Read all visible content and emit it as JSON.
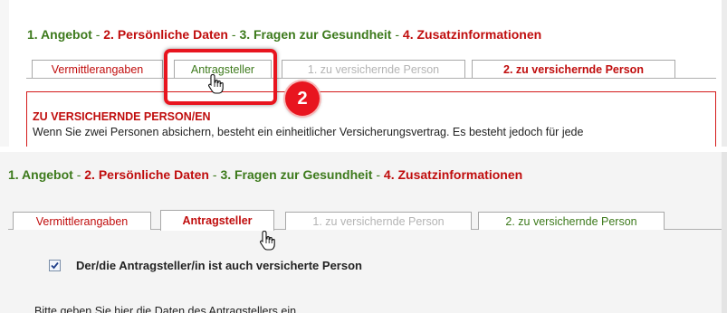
{
  "top": {
    "steps": [
      {
        "label": "1. Angebot",
        "state": "done"
      },
      {
        "label": "2. Persönliche Daten",
        "state": "open"
      },
      {
        "label": "3. Fragen zur Gesundheit",
        "state": "done"
      },
      {
        "label": "4. Zusatzinformationen",
        "state": "open"
      }
    ],
    "separator": " - ",
    "tabs": [
      {
        "label": "Vermittlerangaben"
      },
      {
        "label": "Antragsteller"
      },
      {
        "label": "1. zu versichernde Person"
      },
      {
        "label": "2. zu versichernde Person"
      }
    ],
    "info_title": "ZU VERSICHERNDE PERSON/EN",
    "info_text": "Wenn Sie zwei Personen absichern, besteht ein einheitlicher Versicherungsvertrag. Es besteht jedoch für jede",
    "badge_number": "2"
  },
  "bottom": {
    "steps": [
      {
        "label": "1. Angebot",
        "state": "done"
      },
      {
        "label": "2. Persönliche Daten",
        "state": "open"
      },
      {
        "label": "3. Fragen zur Gesundheit",
        "state": "done"
      },
      {
        "label": "4. Zusatzinformationen",
        "state": "open"
      }
    ],
    "separator": " - ",
    "tabs": [
      {
        "label": "Vermittlerangaben"
      },
      {
        "label": "Antragsteller"
      },
      {
        "label": "1. zu versichernde Person"
      },
      {
        "label": "2. zu versichernde Person"
      }
    ],
    "checkbox_label": "Der/die Antragsteller/in ist auch versicherte Person",
    "checkbox_checked": true,
    "intro_text": "Bitte geben Sie hier die Daten des Antragstellers ein"
  },
  "colors": {
    "step_done": "#3d7a1c",
    "step_open": "#c00d0d",
    "highlight": "#e8151f"
  },
  "icons": [
    "hand-pointer-icon",
    "checkmark-icon"
  ]
}
